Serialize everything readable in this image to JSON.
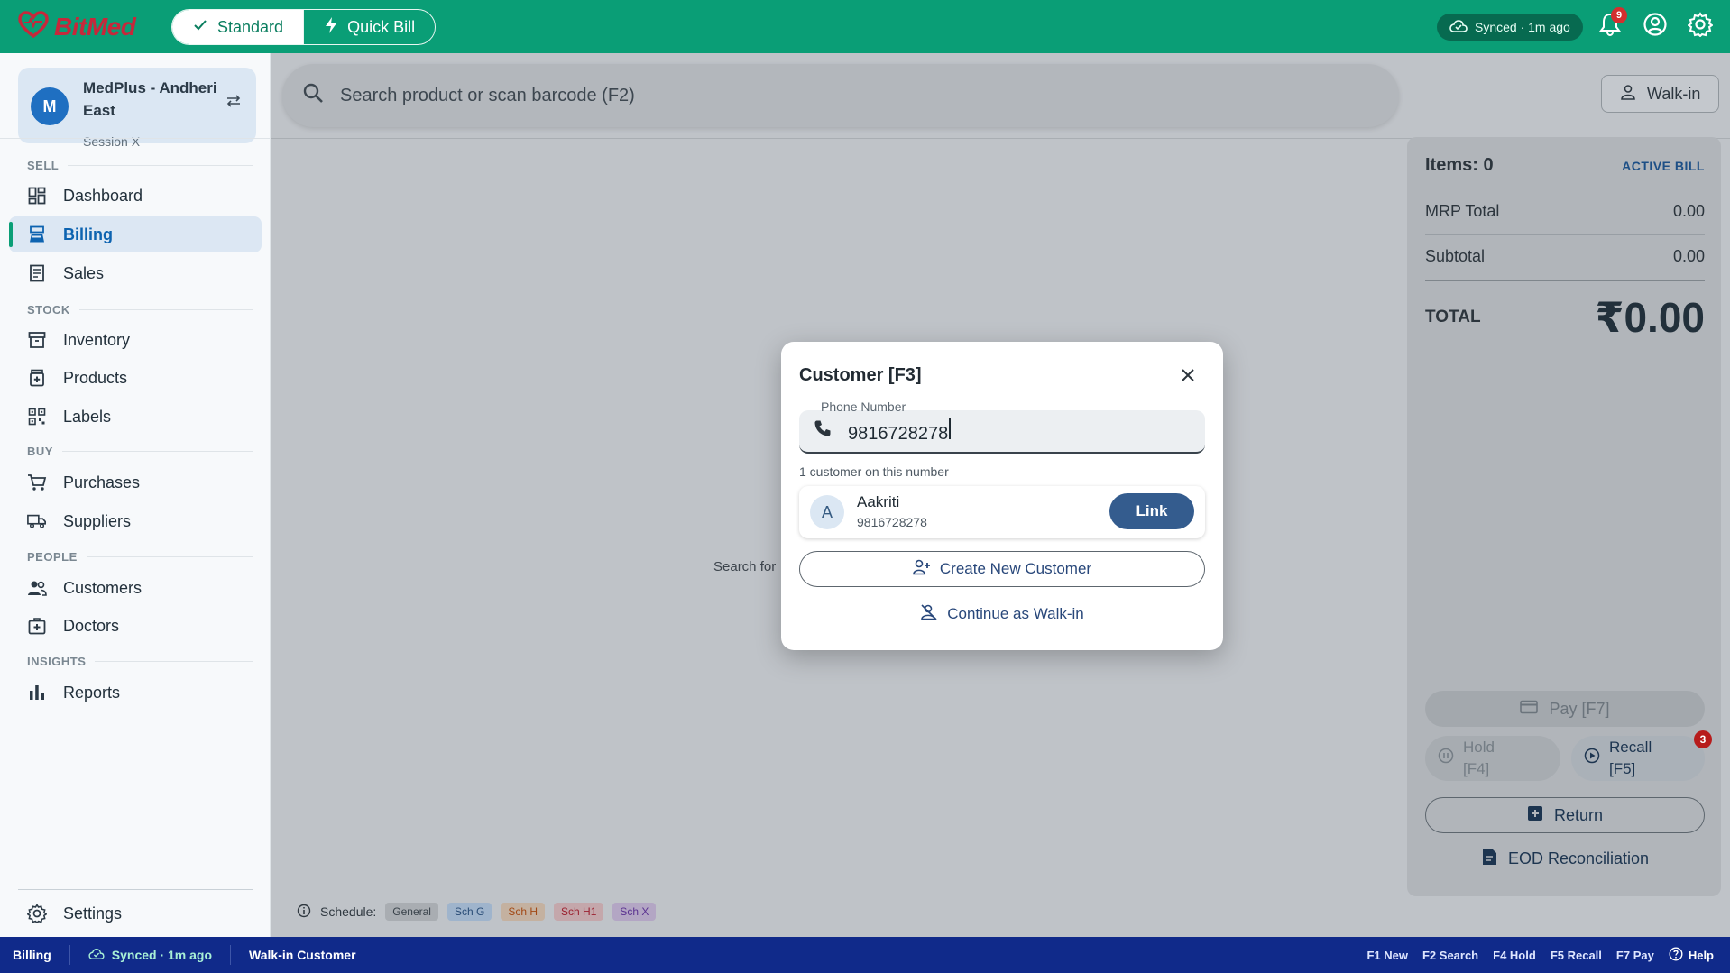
{
  "app": {
    "logo_text": "BitMed",
    "modes": {
      "standard": "Standard",
      "quick_bill": "Quick Bill"
    },
    "sync_status": "Synced · 1m ago",
    "notifications_count": "9"
  },
  "sidebar": {
    "store_initial": "M",
    "store_name": "MedPlus - Andheri East",
    "session": "Session X",
    "sections": {
      "sell": "SELL",
      "stock": "STOCK",
      "buy": "BUY",
      "people": "PEOPLE",
      "insights": "INSIGHTS"
    },
    "items": {
      "dashboard": "Dashboard",
      "billing": "Billing",
      "sales": "Sales",
      "inventory": "Inventory",
      "products": "Products",
      "labels": "Labels",
      "purchases": "Purchases",
      "suppliers": "Suppliers",
      "customers": "Customers",
      "doctors": "Doctors",
      "reports": "Reports",
      "settings": "Settings"
    },
    "active_item": "billing"
  },
  "main": {
    "search_placeholder": "Search product or scan barcode (F2)",
    "walkin_button": "Walk-in",
    "center_hint_partial": "Search for"
  },
  "bill": {
    "items_label": "Items: 0",
    "status": "ACTIVE BILL",
    "mrp_total_label": "MRP Total",
    "mrp_total_value": "0.00",
    "subtotal_label": "Subtotal",
    "subtotal_value": "0.00",
    "total_label": "TOTAL",
    "total_value": "₹0.00",
    "pay_label": "Pay  [F7]",
    "hold_label_1": "Hold",
    "hold_label_2": "[F4]",
    "recall_label_1": "Recall",
    "recall_label_2": "[F5]",
    "recall_count": "3",
    "return_label": "Return",
    "eod_label": "EOD Reconciliation"
  },
  "schedule_legend": {
    "label": "Schedule:",
    "chips": [
      "General",
      "Sch G",
      "Sch H",
      "Sch H1",
      "Sch X"
    ],
    "chip_colors": {
      "General": {
        "bg": "#a9adb2",
        "fg": "#3a434b"
      },
      "Sch G": {
        "bg": "#9fb4cc",
        "fg": "#2a4d77"
      },
      "Sch H": {
        "bg": "#c4b1a0",
        "fg": "#a24a16"
      },
      "Sch H1": {
        "bg": "#c4a7ab",
        "fg": "#9b2130"
      },
      "Sch X": {
        "bg": "#b3a6c4",
        "fg": "#5b3391"
      }
    }
  },
  "customer_modal": {
    "title": "Customer  [F3]",
    "phone_label": "Phone Number",
    "phone_value": "9816728278",
    "match_count_text": "1 customer on this number",
    "match": {
      "initial": "A",
      "name": "Aakriti",
      "phone": "9816728278",
      "link_label": "Link"
    },
    "create_label": "Create New Customer",
    "walkin_label": "Continue as Walk-in"
  },
  "statusbar": {
    "page": "Billing",
    "sync": "Synced · 1m ago",
    "customer": "Walk-in Customer",
    "shortcuts": [
      "F1 New",
      "F2 Search",
      "F4 Hold",
      "F5 Recall",
      "F7 Pay"
    ],
    "help": "Help"
  },
  "colors": {
    "brand_green": "#0a9e76",
    "status_bar": "#102a8a",
    "link_button": "#345c8e",
    "accent_red": "#d32f2f"
  }
}
